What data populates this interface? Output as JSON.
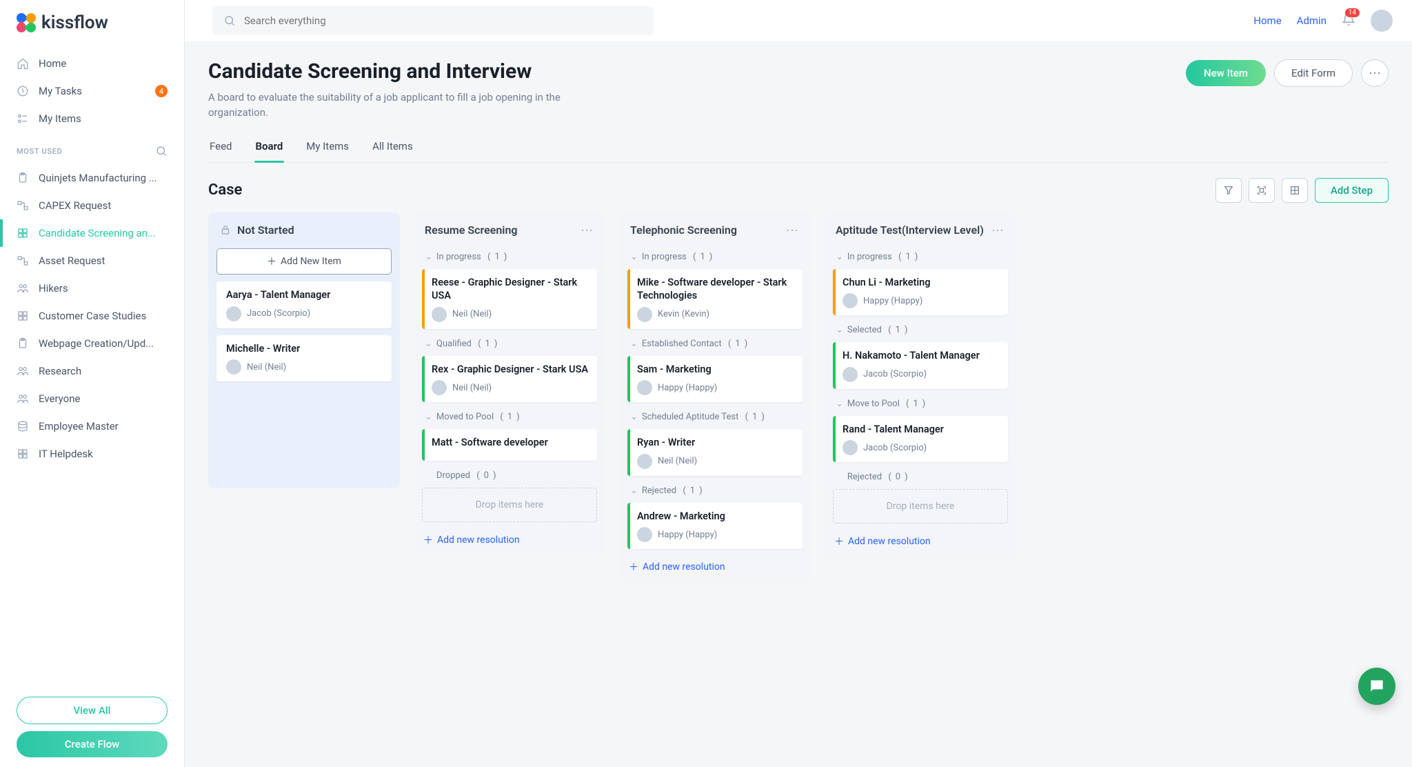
{
  "brand": "kissflow",
  "search": {
    "placeholder": "Search everything"
  },
  "topbar": {
    "links": [
      "Home",
      "Admin"
    ],
    "notification_count": "14"
  },
  "sidebar": {
    "primary": [
      {
        "label": "Home",
        "icon": "home"
      },
      {
        "label": "My Tasks",
        "icon": "clock",
        "badge": "4"
      },
      {
        "label": "My Items",
        "icon": "list"
      }
    ],
    "section_label": "MOST USED",
    "most_used": [
      {
        "label": "Quinjets Manufacturing ...",
        "icon": "clipboard"
      },
      {
        "label": "CAPEX Request",
        "icon": "flow"
      },
      {
        "label": "Candidate Screening an...",
        "icon": "grid",
        "active": true
      },
      {
        "label": "Asset Request",
        "icon": "flow"
      },
      {
        "label": "Hikers",
        "icon": "people"
      },
      {
        "label": "Customer Case Studies",
        "icon": "grid"
      },
      {
        "label": "Webpage Creation/Upd...",
        "icon": "clipboard"
      },
      {
        "label": "Research",
        "icon": "people"
      },
      {
        "label": "Everyone",
        "icon": "people"
      },
      {
        "label": "Employee Master",
        "icon": "db"
      },
      {
        "label": "IT Helpdesk",
        "icon": "grid"
      }
    ],
    "view_all": "View All",
    "create_flow": "Create Flow"
  },
  "page": {
    "title": "Candidate Screening and Interview",
    "description": "A board to evaluate the suitability of a job applicant to fill a job opening in the organization.",
    "new_item": "New Item",
    "edit_form": "Edit Form"
  },
  "tabs": [
    "Feed",
    "Board",
    "My Items",
    "All Items"
  ],
  "active_tab": "Board",
  "board": {
    "title": "Case",
    "add_step": "Add Step",
    "add_new_item": "Add New Item",
    "add_new_resolution": "Add new resolution",
    "drop_hint": "Drop items here",
    "columns": [
      {
        "title": "Not Started",
        "locked": true,
        "first": true,
        "sections": [
          {
            "cards": [
              {
                "title": "Aarya - Talent Manager",
                "assignee": "Jacob (Scorpio)"
              },
              {
                "title": "Michelle - Writer",
                "assignee": "Neil (Neil)"
              }
            ]
          }
        ]
      },
      {
        "title": "Resume Screening",
        "menu": true,
        "sections": [
          {
            "label": "In progress",
            "count": 1,
            "cards": [
              {
                "title": "Reese - Graphic Designer - Stark USA",
                "assignee": "Neil (Neil)",
                "accent": "orange"
              }
            ]
          },
          {
            "label": "Qualified",
            "count": 1,
            "cards": [
              {
                "title": "Rex - Graphic Designer - Stark USA",
                "assignee": "Neil (Neil)",
                "accent": "green"
              }
            ]
          },
          {
            "label": "Moved to Pool",
            "count": 1,
            "cards": [
              {
                "title": "Matt - Software developer",
                "accent": "green"
              }
            ]
          },
          {
            "label": "Dropped",
            "count": 0,
            "no_toggle": true,
            "dropzone": true
          }
        ],
        "add_resolution": true
      },
      {
        "title": "Telephonic Screening",
        "menu": true,
        "sections": [
          {
            "label": "In progress",
            "count": 1,
            "cards": [
              {
                "title": "Mike - Software developer - Stark Technologies",
                "assignee": "Kevin (Kevin)",
                "accent": "orange"
              }
            ]
          },
          {
            "label": "Established Contact",
            "count": 1,
            "cards": [
              {
                "title": "Sam - Marketing",
                "assignee": "Happy (Happy)",
                "accent": "green"
              }
            ]
          },
          {
            "label": "Scheduled Aptitude Test",
            "count": 1,
            "cards": [
              {
                "title": "Ryan - Writer",
                "assignee": "Neil (Neil)",
                "accent": "green"
              }
            ]
          },
          {
            "label": "Rejected",
            "count": 1,
            "cards": [
              {
                "title": "Andrew - Marketing",
                "assignee": "Happy (Happy)",
                "accent": "green"
              }
            ]
          }
        ],
        "add_resolution": true
      },
      {
        "title": "Aptitude Test(Interview Level)",
        "menu": true,
        "sections": [
          {
            "label": "In progress",
            "count": 1,
            "cards": [
              {
                "title": "Chun Li - Marketing",
                "assignee": "Happy (Happy)",
                "accent": "orange"
              }
            ]
          },
          {
            "label": "Selected",
            "count": 1,
            "cards": [
              {
                "title": "H. Nakamoto - Talent Manager",
                "assignee": "Jacob (Scorpio)",
                "accent": "green"
              }
            ]
          },
          {
            "label": "Move to Pool",
            "count": 1,
            "cards": [
              {
                "title": "Rand - Talent Manager",
                "assignee": "Jacob (Scorpio)",
                "accent": "green"
              }
            ]
          },
          {
            "label": "Rejected",
            "count": 0,
            "no_toggle": true,
            "dropzone": true
          }
        ],
        "add_resolution": true
      }
    ]
  }
}
